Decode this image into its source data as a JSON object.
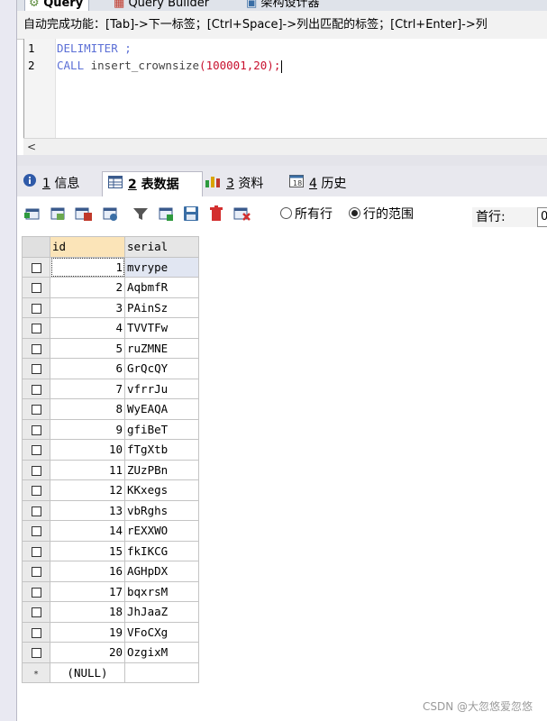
{
  "top_tabs": [
    {
      "label": "Query",
      "active": true
    },
    {
      "label": "Query Builder",
      "active": false
    },
    {
      "label": "架构设计器",
      "active": false
    }
  ],
  "hint_text": "自动完成功能：[Tab]->下一标签；[Ctrl+Space]->列出匹配的标签；[Ctrl+Enter]->列",
  "editor": {
    "lines": [
      {
        "num": "1",
        "keyword": "DELIMITER",
        "rest": " ;"
      },
      {
        "num": "2",
        "keyword": "CALL",
        "fn": " insert_crownsize",
        "args": "(100001,20);"
      }
    ]
  },
  "scroll_arrow": "<",
  "result_tabs": [
    {
      "num": "1",
      "label": "信息",
      "icon": "info-icon",
      "active": false
    },
    {
      "num": "2",
      "label": "表数据",
      "icon": "table-data-icon",
      "active": true
    },
    {
      "num": "3",
      "label": "资料",
      "icon": "profile-icon",
      "active": false
    },
    {
      "num": "4",
      "label": "历史",
      "icon": "calendar-icon",
      "active": false
    }
  ],
  "toolbar": {
    "radio_all_rows": "所有行",
    "radio_row_range": "行的范围",
    "radio_selected": "row_range",
    "first_row_label": "首行:",
    "first_row_value": "0"
  },
  "grid": {
    "columns": [
      "id",
      "serial"
    ],
    "rows": [
      {
        "id": "1",
        "serial": "mvrype"
      },
      {
        "id": "2",
        "serial": "AqbmfR"
      },
      {
        "id": "3",
        "serial": "PAinSz"
      },
      {
        "id": "4",
        "serial": "TVVTFw"
      },
      {
        "id": "5",
        "serial": "ruZMNE"
      },
      {
        "id": "6",
        "serial": "GrQcQY"
      },
      {
        "id": "7",
        "serial": "vfrrJu"
      },
      {
        "id": "8",
        "serial": "WyEAQA"
      },
      {
        "id": "9",
        "serial": "gfiBeT"
      },
      {
        "id": "10",
        "serial": "fTgXtb"
      },
      {
        "id": "11",
        "serial": "ZUzPBn"
      },
      {
        "id": "12",
        "serial": "KKxegs"
      },
      {
        "id": "13",
        "serial": "vbRghs"
      },
      {
        "id": "14",
        "serial": "rEXXWO"
      },
      {
        "id": "15",
        "serial": "fkIKCG"
      },
      {
        "id": "16",
        "serial": "AGHpDX"
      },
      {
        "id": "17",
        "serial": "bqxrsM"
      },
      {
        "id": "18",
        "serial": "JhJaaZ"
      },
      {
        "id": "19",
        "serial": "VFoCXg"
      },
      {
        "id": "20",
        "serial": "OzgixM"
      }
    ],
    "new_row_marker": "*",
    "null_text": "(NULL)"
  },
  "watermark": "CSDN @大忽悠爱忽悠",
  "colors": {
    "keyword": "#5b6fd6",
    "number": "#c8102e",
    "active_column_header": "#fbe4b8",
    "selected_cell": "#e1e6f2"
  }
}
